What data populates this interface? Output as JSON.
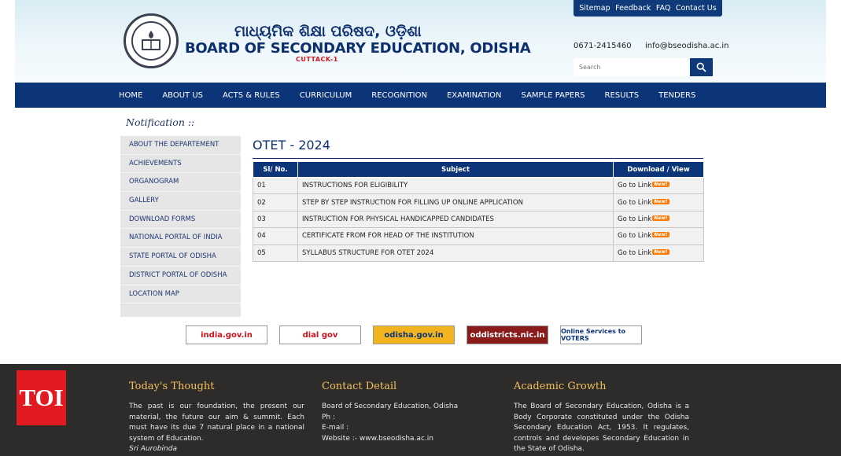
{
  "header": {
    "top_links": [
      "Sitemap",
      "Feedback",
      "FAQ",
      "Contact Us"
    ],
    "title_odia": "ମାଧ୍ୟମିକ ଶିକ୍ଷା ପରିଷଦ, ଓଡ଼ିଶା",
    "title_english": "BOARD OF SECONDARY EDUCATION, ODISHA",
    "subtitle": "CUTTACK-1",
    "seal_text": "BOARD OF SECONDARY EDUCATION ODISHA",
    "phone": "0671-2415460",
    "email": "info@bseodisha.ac.in",
    "search_placeholder": "Search",
    "search_icon": "search-icon"
  },
  "nav": {
    "items": [
      "HOME",
      "ABOUT US",
      "ACTS & RULES",
      "CURRICULUM",
      "RECOGNITION",
      "EXAMINATION",
      "SAMPLE PAPERS",
      "RESULTS",
      "TENDERS"
    ]
  },
  "page": {
    "notification_label": "Notification ::",
    "heading": "OTET - 2024"
  },
  "sidebar": {
    "items": [
      "ABOUT THE DEPARTEMENT",
      "ACHIEVEMENTS",
      "ORGANOGRAM",
      "GALLERY",
      "DOWNLOAD FORMS",
      "NATIONAL PORTAL OF INDIA",
      "STATE PORTAL OF ODISHA",
      "DISTRICT PORTAL OF ODISHA",
      "LOCATION MAP"
    ]
  },
  "table": {
    "headers": [
      "Sl/ No.",
      "Subject",
      "Download / View"
    ],
    "link_label": "Go to Link",
    "badge": "New!",
    "rows": [
      {
        "no": "01",
        "subject": "INSTRUCTIONS FOR ELIGIBILITY"
      },
      {
        "no": "02",
        "subject": "STEP BY STEP INSTRUCTION FOR FILLING UP ONLINE APPLICATION"
      },
      {
        "no": "03",
        "subject": "INSTRUCTION FOR PHYSICAL HANDICAPPED CANDIDATES"
      },
      {
        "no": "04",
        "subject": "CERTIFICATE FROM FOR HEAD OF THE INSTITUTION"
      },
      {
        "no": "05",
        "subject": "SYLLABUS STRUCTURE FOR OTET 2024"
      }
    ]
  },
  "logos": [
    "india.gov.in",
    "dial gov",
    "odisha.gov.in",
    "oddistricts.nic.in",
    "Online Services to VOTERS"
  ],
  "footer": {
    "thought_title": "Today's Thought",
    "thought_text": "The past is our foundation, the present our material, the future our aim & summit. Each must have its due 7 natural place in a national system of Education.",
    "thought_author": "Sri Aurobinda",
    "contact_title": "Contact Detail",
    "contact_org": "Board of Secondary Education, Odisha",
    "contact_ph": "Ph :",
    "contact_email": "E-mail :",
    "contact_website": "Website :- www.bseodisha.ac.in",
    "growth_title": "Academic Growth",
    "growth_text": "The Board of Secondary Education, Odisha is a Body Corporate constituted under the Odisha Secondary Education Act, 1953. It regulates, controls and developes Secondary Education in the State of Odisha."
  },
  "watermark": "TOI",
  "colors": {
    "navy": "#0c3478",
    "accent_red": "#d0121b",
    "footer_bg": "#2e2b2b",
    "footer_heading": "#f3c05a"
  }
}
